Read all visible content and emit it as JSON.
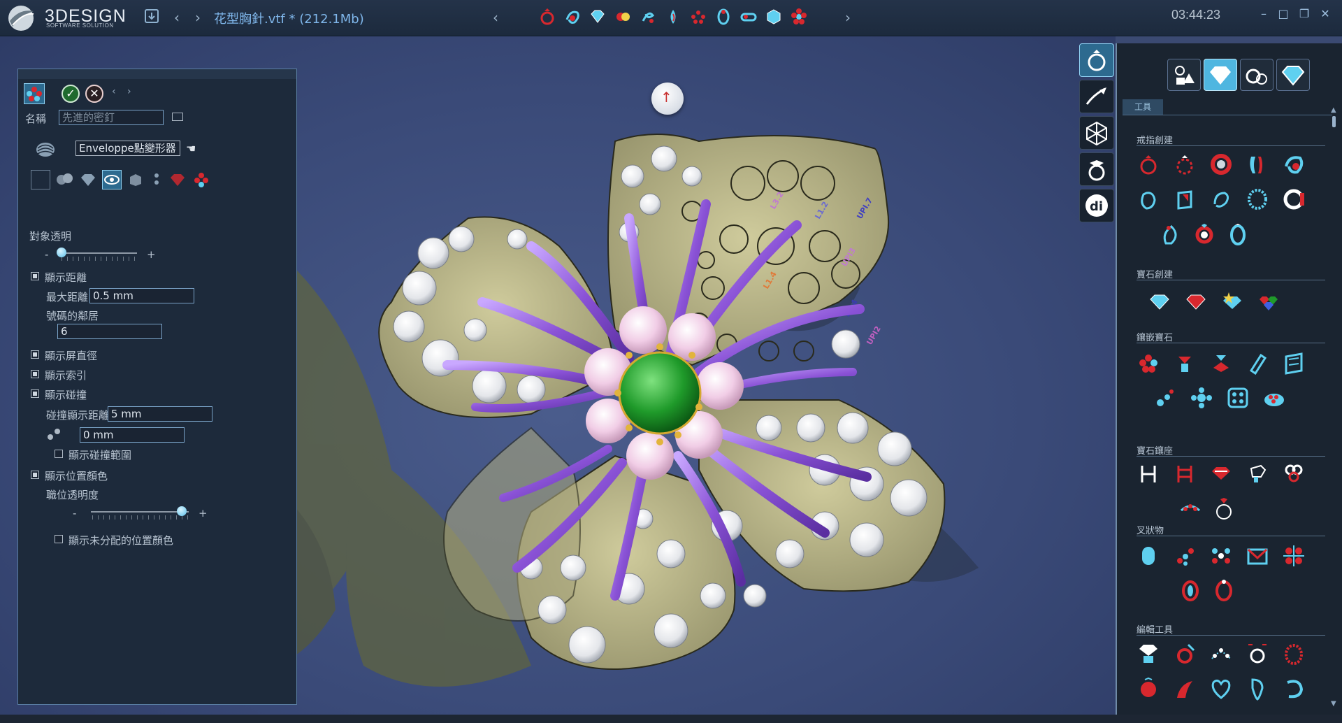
{
  "app": {
    "logo_text": "3DESIGN",
    "logo_subtitle": "SOFTWARE SOLUTION",
    "file_title": "花型胸針.vtf * (212.1Mb)",
    "clock": "03:44:23"
  },
  "titlebar": {
    "save_icon": "save-icon",
    "back_glyph": "‹",
    "forward_glyph": "›",
    "scroll_left_glyph": "‹",
    "scroll_right_glyph": "›",
    "minimize_glyph": "–",
    "maximize_glyph": "□",
    "restore_glyph": "❐",
    "close_glyph": "✕",
    "quick_icons": [
      "ring-icon",
      "twist-icon",
      "gem-icon",
      "gem-pair-icon",
      "spiral-icon",
      "drop-icon",
      "cluster-icon",
      "band-icon",
      "link-icon",
      "cube-icon",
      "flower-icon"
    ]
  },
  "viewport": {
    "grid_glyph": "⠿",
    "nav_glyph": "↑"
  },
  "panel": {
    "name_label": "名稱",
    "name_value": "先進的密釘",
    "deformer_value": "Enveloppe點變形器",
    "object_transparency_label": "對象透明",
    "object_transparency": 0.02,
    "minus": "-",
    "plus": "+",
    "show_distance_label": "顯示距離",
    "max_distance_label": "最大距離",
    "max_distance_value": "0.5 mm",
    "neighbor_count_label": "號碼的鄰居",
    "neighbor_count_value": "6",
    "show_screen_diameter_label": "顯示屏直徑",
    "show_index_label": "顯示索引",
    "show_collision_label": "顯示碰撞",
    "collision_distance_label": "碰撞顯示距離",
    "collision_distance_value": "5 mm",
    "collision_offset_value": "0 mm",
    "show_collision_range_label": "顯示碰撞範圍",
    "show_position_color_label": "顯示位置顏色",
    "position_transparency_label": "職位透明度",
    "position_transparency": 0.93,
    "show_unassigned_color_label": "顯示未分配的位置顏色",
    "checks": {
      "show_distance": true,
      "show_screen_diameter": true,
      "show_index": true,
      "show_collision": true,
      "show_collision_range": false,
      "show_position_color": true,
      "show_unassigned_color": false
    }
  },
  "tools": {
    "tab_label": "工具",
    "sections": [
      {
        "title": "戒指創建"
      },
      {
        "title": "寶石創建"
      },
      {
        "title": "鑲嵌寶石"
      },
      {
        "title": "寶石鑲座"
      },
      {
        "title": "叉狀物"
      },
      {
        "title": "編輯工具"
      }
    ]
  },
  "colors": {
    "accent": "#4fb6e0",
    "tool_red": "#d8282e",
    "tool_cyan": "#5fd0f0",
    "petal": "#b6b38a",
    "prong_purple": "#8a52d6",
    "emerald": "#1f9a2a",
    "pink_gem": "#f1cde6"
  }
}
